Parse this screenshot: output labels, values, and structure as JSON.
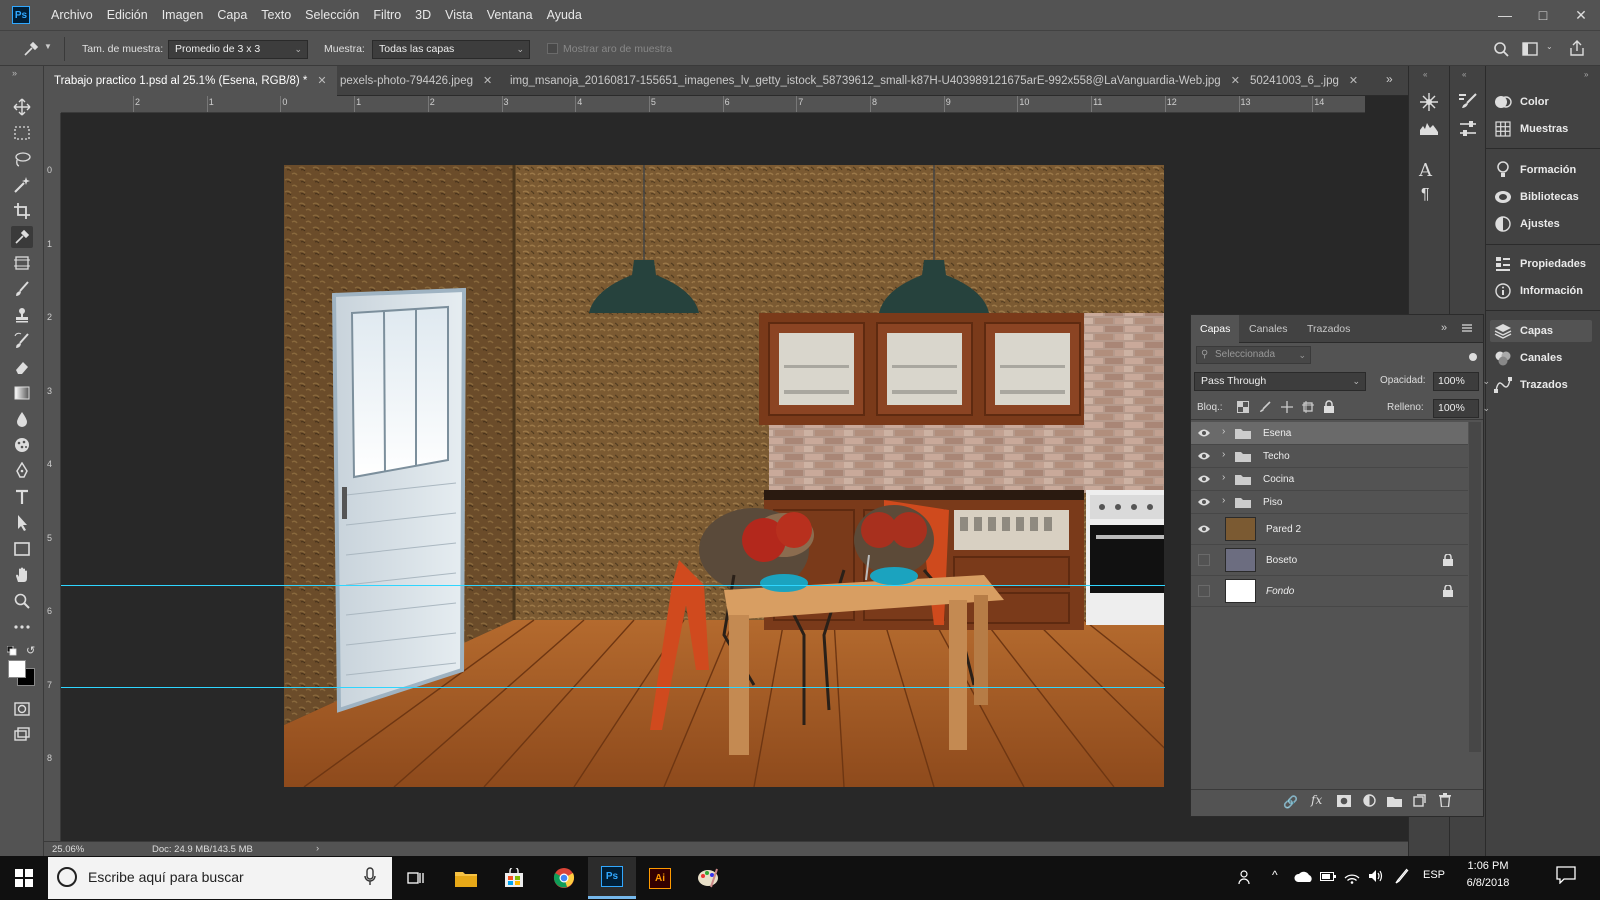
{
  "app": {
    "logo": "Ps"
  },
  "menu": [
    "Archivo",
    "Edición",
    "Imagen",
    "Capa",
    "Texto",
    "Selección",
    "Filtro",
    "3D",
    "Vista",
    "Ventana",
    "Ayuda"
  ],
  "options": {
    "sample_size_label": "Tam. de muestra:",
    "sample_size_value": "Promedio de 3 x 3",
    "sample_label": "Muestra:",
    "sample_value": "Todas las capas",
    "show_ring_label": "Mostrar aro de muestra"
  },
  "tabs": [
    {
      "label": "Trabajo practico 1.psd al 25.1% (Esena, RGB/8) *",
      "active": true
    },
    {
      "label": "pexels-photo-794426.jpeg",
      "active": false
    },
    {
      "label": "img_msanoja_20160817-155651_imagenes_lv_getty_istock_58739612_small-k87H-U403989121675arE-992x558@LaVanguardia-Web.jpg",
      "active": false
    },
    {
      "label": "50241003_6_.jpg",
      "active": false
    }
  ],
  "ruler_top": [
    "2",
    "1",
    "0",
    "1",
    "2",
    "3",
    "4",
    "5",
    "6",
    "7",
    "8",
    "9",
    "10",
    "11",
    "12",
    "13",
    "14"
  ],
  "ruler_left": [
    "0",
    "1",
    "2",
    "3",
    "4",
    "5",
    "6",
    "7",
    "8"
  ],
  "status": {
    "zoom": "25.06%",
    "doc": "Doc: 24.9 MB/143.5 MB"
  },
  "right_panel": {
    "group1": [
      "Color",
      "Muestras"
    ],
    "group2": [
      "Formación",
      "Bibliotecas",
      "Ajustes"
    ],
    "group3": [
      "Propiedades",
      "Información"
    ],
    "group4": [
      "Capas",
      "Canales",
      "Trazados"
    ]
  },
  "layers_panel": {
    "tabs": [
      "Capas",
      "Canales",
      "Trazados"
    ],
    "filter_placeholder": "Seleccionada",
    "blend_mode": "Pass Through",
    "opacity_label": "Opacidad:",
    "opacity_value": "100%",
    "lock_label": "Bloq.:",
    "fill_label": "Relleno:",
    "fill_value": "100%",
    "layers": [
      {
        "name": "Esena",
        "type": "group",
        "visible": true,
        "selected": true
      },
      {
        "name": "Techo",
        "type": "group",
        "visible": true
      },
      {
        "name": "Cocina",
        "type": "group",
        "visible": true
      },
      {
        "name": "Piso",
        "type": "group",
        "visible": true
      },
      {
        "name": "Pared 2",
        "type": "image",
        "visible": true
      },
      {
        "name": "Boseto",
        "type": "image",
        "visible": false,
        "locked": true
      },
      {
        "name": "Fondo",
        "type": "background",
        "visible": false,
        "locked": true
      }
    ]
  },
  "taskbar": {
    "search_placeholder": "Escribe aquí para buscar",
    "language": "ESP",
    "time": "1:06 PM",
    "date": "6/8/2018"
  }
}
